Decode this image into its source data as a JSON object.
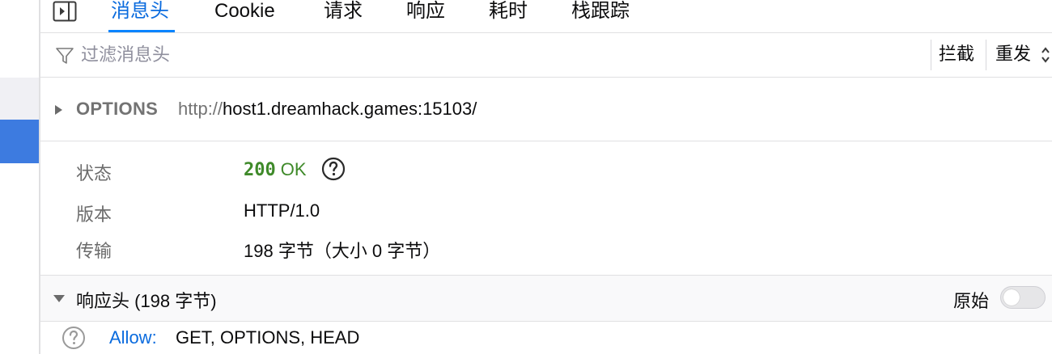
{
  "left_panel": {
    "selected_color": "#3d7be0",
    "row_color": "#f0f0f4"
  },
  "tabs": [
    {
      "label": "消息头",
      "active": true
    },
    {
      "label": "Cookie",
      "active": false
    },
    {
      "label": "请求",
      "active": false
    },
    {
      "label": "响应",
      "active": false
    },
    {
      "label": "耗时",
      "active": false
    },
    {
      "label": "栈跟踪",
      "active": false
    }
  ],
  "filter": {
    "placeholder": "过滤消息头",
    "block_label": "拦截",
    "resend_label": "重发"
  },
  "request": {
    "method": "OPTIONS",
    "url_scheme": "http://",
    "url_rest": "host1.dreamhack.games:15103/"
  },
  "info": {
    "status_label": "状态",
    "status_code": "200",
    "status_text": "OK",
    "version_label": "版本",
    "version_value": "HTTP/1.0",
    "transfer_label": "传输",
    "transfer_value": "198 字节（大小 0 字节）"
  },
  "response_headers": {
    "title": "响应头 (198 字节)",
    "raw_label": "原始",
    "raw_on": false,
    "items": [
      {
        "name": "Allow:",
        "value": "GET, OPTIONS, HEAD"
      }
    ]
  },
  "colors": {
    "accent": "#0a84ff",
    "status_ok": "#3f8a2a",
    "header_name": "#0a6bde"
  }
}
